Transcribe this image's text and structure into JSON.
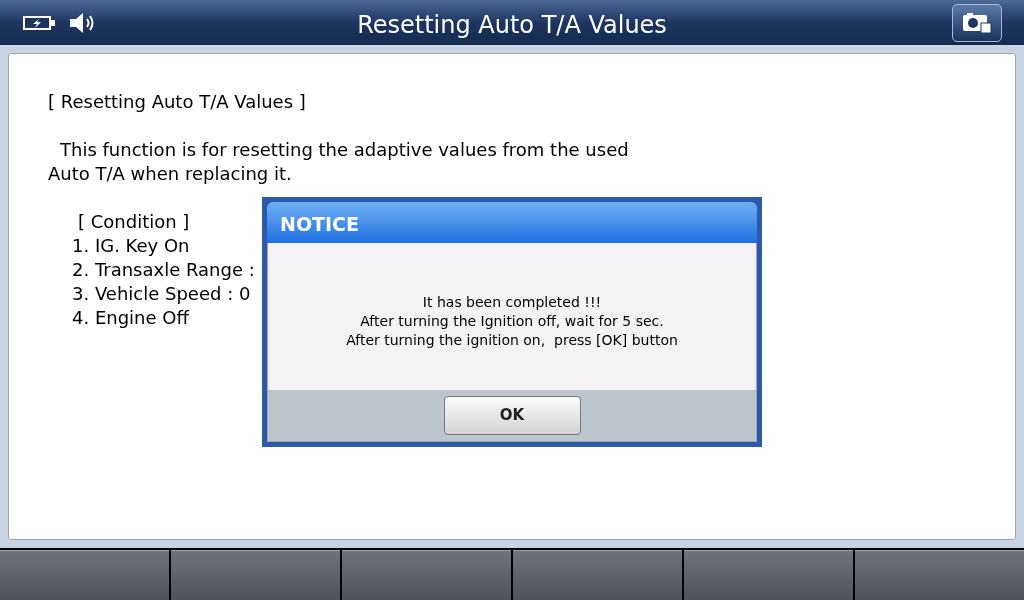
{
  "header": {
    "title": "Resetting Auto T/A Values"
  },
  "content": {
    "heading": "[ Resetting Auto T/A Values ]",
    "description": [
      "This function is for resetting the adaptive values from the used",
      "Auto T/A when replacing it."
    ],
    "condition_heading": "[ Condition ]",
    "conditions": [
      "1. IG. Key On",
      "2. Transaxle Range :",
      "3. Vehicle Speed : 0",
      "4. Engine Off"
    ]
  },
  "dialog": {
    "title": "NOTICE",
    "message": [
      "It has been completed !!!",
      "After turning the Ignition off, wait for 5 sec.",
      "After turning the ignition on,  press [OK] button"
    ],
    "button": "OK"
  }
}
